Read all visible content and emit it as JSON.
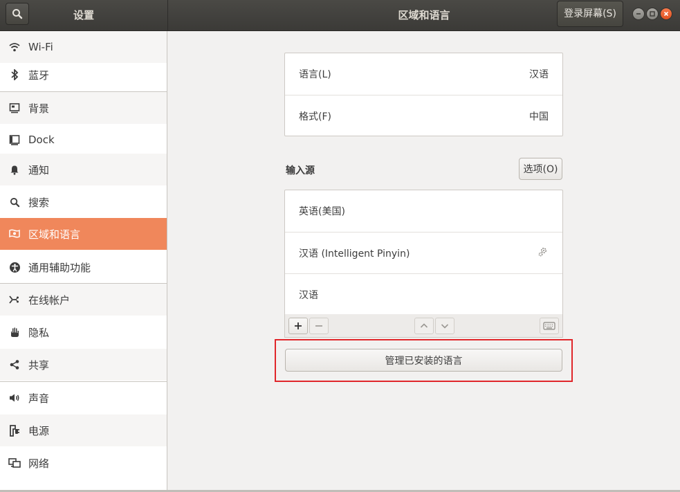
{
  "colors": {
    "accent": "#f0875b",
    "header_bg": "#3c3b37",
    "close_button": "#e95420",
    "highlight_box": "#e0262a"
  },
  "header": {
    "sidebar_title": "设置",
    "title": "区域和语言",
    "lock_button": "登录屏幕(S)",
    "search_icon": "search-icon",
    "window_controls": [
      "minimize",
      "maximize",
      "close"
    ]
  },
  "sidebar": {
    "items": [
      {
        "label": "Wi-Fi",
        "icon": "wifi-icon"
      },
      {
        "label": "蓝牙",
        "icon": "bluetooth-icon"
      },
      {
        "label": "背景",
        "icon": "background-icon"
      },
      {
        "label": "Dock",
        "icon": "dock-icon"
      },
      {
        "label": "通知",
        "icon": "bell-icon"
      },
      {
        "label": "搜索",
        "icon": "search-icon"
      },
      {
        "label": "区域和语言",
        "icon": "region-flag-icon",
        "selected": true
      },
      {
        "label": "通用辅助功能",
        "icon": "accessibility-icon"
      },
      {
        "label": "在线帐户",
        "icon": "online-accounts-icon"
      },
      {
        "label": "隐私",
        "icon": "hand-icon"
      },
      {
        "label": "共享",
        "icon": "share-icon"
      },
      {
        "label": "声音",
        "icon": "speaker-icon"
      },
      {
        "label": "电源",
        "icon": "power-plug-icon"
      },
      {
        "label": "网络",
        "icon": "network-icon"
      }
    ]
  },
  "main": {
    "language": {
      "label": "语言(L)",
      "value": "汉语"
    },
    "formats": {
      "label": "格式(F)",
      "value": "中国"
    },
    "input_sources": {
      "title": "输入源",
      "options_button": "选项(O)",
      "items": [
        {
          "label": "英语(美国)"
        },
        {
          "label": "汉语 (Intelligent Pinyin)",
          "icon": "gear-icon"
        },
        {
          "label": "汉语"
        }
      ],
      "toolbar_icons": [
        "add-icon",
        "remove-icon",
        "chevron-up-icon",
        "chevron-down-icon",
        "keyboard-icon"
      ]
    },
    "manage_button": "管理已安装的语言"
  }
}
